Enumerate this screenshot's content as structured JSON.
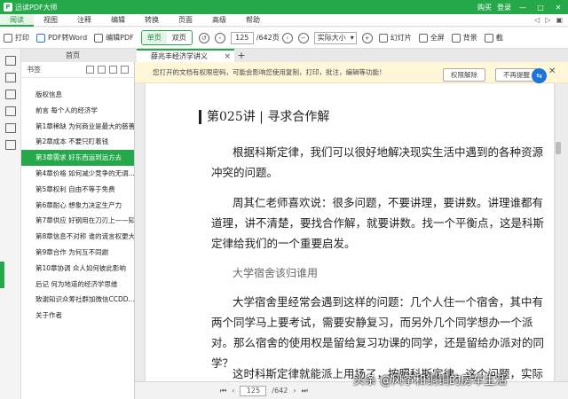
{
  "app": {
    "logo_mark": "P",
    "title": "迅读PDF大师",
    "user_buy": "购买",
    "user_login": "登录",
    "win_min": "—",
    "win_max": "□",
    "win_close": "✕"
  },
  "menu": {
    "items": [
      "阅读",
      "视图",
      "注释",
      "编辑",
      "转换",
      "页面",
      "高级",
      "帮助"
    ],
    "right_icons": [
      "◁",
      "▷",
      "▣"
    ]
  },
  "toolbar": {
    "print": "打印",
    "pdf_to_word": "PDF转Word",
    "edit_pdf": "编辑PDF",
    "single_page": "单页",
    "double_page": "双页",
    "page_current": "125",
    "page_total": "/642页",
    "zoom": "实际大小",
    "slideshow": "幻灯片",
    "fullscreen": "全屏",
    "background": "背景",
    "more": "截"
  },
  "tabs": {
    "home": "首页",
    "doc": "薛兆丰经济学讲义",
    "doc_close": "×",
    "add": "+"
  },
  "sidebar": {
    "header": "书签",
    "bookmarks": [
      "版权信息",
      "前言 每个人的经济学",
      "第1章稀缺 为何商业是最大的慈善",
      "第2章成本 不要只盯着钱",
      "第3章需求 好东西运到远方去",
      "第4章价格 如何减少竞争的无谓...",
      "第5章权利 自由不等于免费",
      "第6章耐心 想象力决定生产力",
      "第7章供应 好钢用在刀刃上——知...",
      "第8章信息不对称 谁的谎言权更大",
      "第9章合作 为何互不同謝",
      "第10章协调 众人如何彼此影响",
      "后记 何为地道的经济学思维",
      "致谢知识众筹社群加微信CCDD...",
      "关于作者"
    ]
  },
  "notice": {
    "message": "您打开的文档有权限密码，可能会影响您使用复制，打印，批注，编辑等功能！",
    "unlock_btn": "权限解除",
    "dismiss_btn": "不再提醒",
    "close": "✕"
  },
  "document": {
    "chapter_title": "第025讲 | 寻求合作解",
    "para1": "根据科斯定律，我们可以很好地解决现实生活中遇到的各种资源冲突的问题。",
    "para2": "周其仁老师喜欢说：很多问题，不要讲理，要讲数。讲理谁都有道理，讲不清楚，要找合作解，就要讲数。找一个平衡点，这是科斯定律给我们的一个重要启发。",
    "subtitle": "大学宿舍该归谁用",
    "para3": "大学宿舍里经常会遇到这样的问题：几个人住一个宿舍，其中有两个同学马上要考试，需要安静复习，而另外几个同学想办一个派对。那么宿舍的使用权是留给复习功课的同学，还是留给办派对的同学？",
    "para4": "这时科斯定律就能派上用场了，按照科斯定律，这个问题，实际上"
  },
  "status": {
    "page_current": "125",
    "page_total": "/642"
  },
  "watermark": "头条 @风筝和铜铜的房车生活",
  "colors": {
    "brand_green": "#25a84a",
    "notice_bg": "#fff7d8"
  }
}
